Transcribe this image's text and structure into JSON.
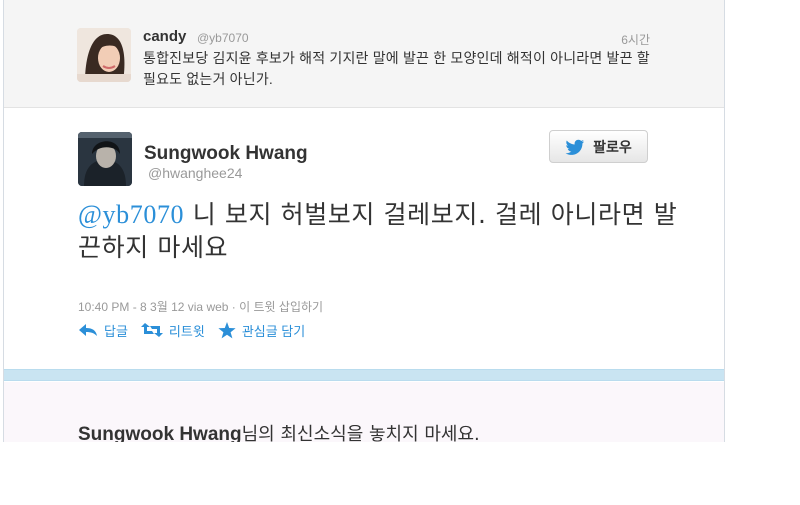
{
  "parent_tweet": {
    "name": "candy",
    "handle": "@yb7070",
    "time": "6시간",
    "text": "통합진보당 김지윤 후보가 해적 기지란 말에 발끈 한 모양인데 해적이 아니라면 발끈 할 필요도 없는거 아닌가."
  },
  "tweet": {
    "name": "Sungwook Hwang",
    "handle": "@hwanghee24",
    "follow_label": "팔로우",
    "mention": "@yb7070",
    "text": " 니 보지 허벌보지 걸레보지. 걸레 아니라면 발끈하지 마세요",
    "meta_time": "10:40 PM - 8 3월 12 via web",
    "meta_sep": " · ",
    "meta_embed": "이 트윗 삽입하기"
  },
  "actions": {
    "reply_label": "답글",
    "retweet_label": "리트윗",
    "favorite_label": "관심글 담기"
  },
  "cta": {
    "name": "Sungwook Hwang",
    "suffix": "님의 최신소식을 놓치지 마세요."
  },
  "colors": {
    "link": "#2b8fd8",
    "text": "#333333",
    "muted": "#999999",
    "divider": "#c9e4f2"
  }
}
